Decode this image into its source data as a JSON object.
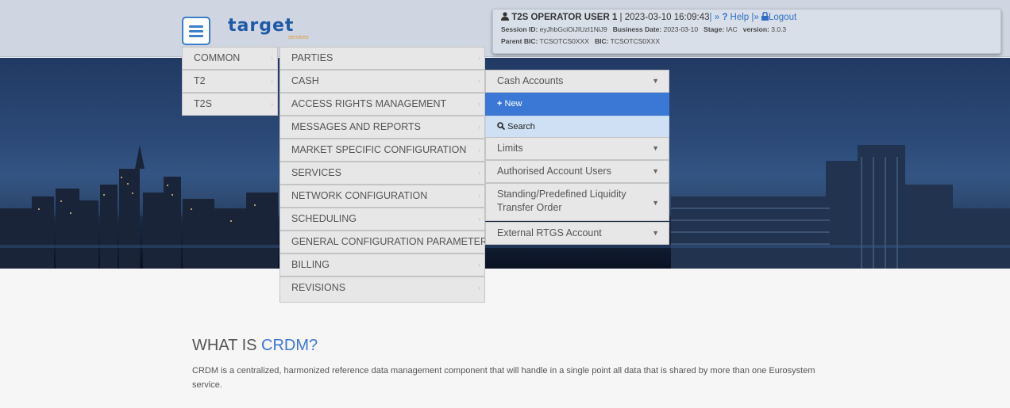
{
  "header": {
    "logo": "target",
    "logo_sub": "services",
    "user": {
      "name": "T2S OPERATOR USER 1",
      "sep1": " | ",
      "datetime": "2023-03-10 16:09:43",
      "sep2": "| » ",
      "help": "Help",
      "sep3": " |» ",
      "logout": "Logout",
      "session_label": "Session ID:",
      "session_value": "eyJhbGciOiJIUzI1NiJ9",
      "bdate_label": "Business Date:",
      "bdate_value": "2023-03-10",
      "stage_label": "Stage:",
      "stage_value": "IAC",
      "version_label": "version:",
      "version_value": "3.0.3",
      "parent_bic_label": "Parent BIC:",
      "parent_bic_value": "TCSOTCS0XXX",
      "bic_label": "BIC:",
      "bic_value": "TCSOTCS0XXX"
    }
  },
  "menu": {
    "level1": [
      "COMMON",
      "T2",
      "T2S"
    ],
    "level2": [
      "PARTIES",
      "CASH",
      "ACCESS RIGHTS MANAGEMENT",
      "MESSAGES AND REPORTS",
      "MARKET SPECIFIC CONFIGURATION",
      "SERVICES",
      "NETWORK CONFIGURATION",
      "SCHEDULING",
      "GENERAL CONFIGURATION PARAMETERS",
      "BILLING",
      "REVISIONS"
    ],
    "level3": {
      "cash_accounts": "Cash Accounts",
      "new": "New",
      "search": "Search",
      "limits": "Limits",
      "authorised_users": "Authorised Account Users",
      "standing_line1": "Standing/Predefined Liquidity",
      "standing_line2": "Transfer Order",
      "external_rtgs": "External RTGS Account"
    }
  },
  "content": {
    "title_prefix": "WHAT IS ",
    "title_highlight": "CRDM?",
    "text": "CRDM is a centralized, harmonized reference data management component that will handle in a single point all data that is shared by more than one Eurosystem service."
  }
}
